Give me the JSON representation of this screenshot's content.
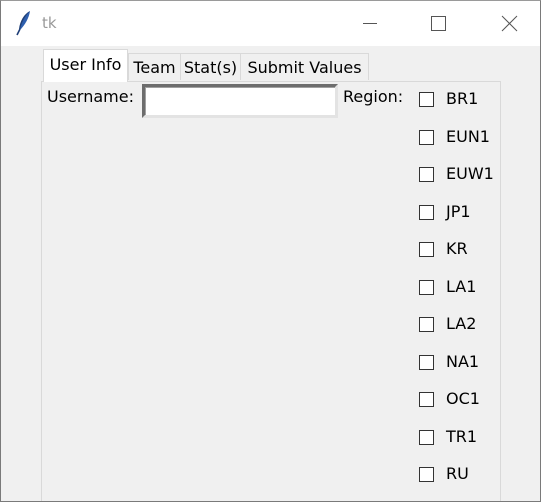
{
  "window": {
    "title": "tk",
    "icon": "feather-icon",
    "controls": [
      "minimize-icon",
      "maximize-icon",
      "close-icon"
    ]
  },
  "tabs": [
    {
      "label": "User Info",
      "selected": true
    },
    {
      "label": "Team",
      "selected": false
    },
    {
      "label": "Stat(s)",
      "selected": false
    },
    {
      "label": "Submit Values",
      "selected": false
    }
  ],
  "user_info": {
    "username_label": "Username:",
    "username_value": "",
    "region_label": "Region:",
    "regions": [
      {
        "label": "BR1",
        "checked": false
      },
      {
        "label": "EUN1",
        "checked": false
      },
      {
        "label": "EUW1",
        "checked": false
      },
      {
        "label": "JP1",
        "checked": false
      },
      {
        "label": "KR",
        "checked": false
      },
      {
        "label": "LA1",
        "checked": false
      },
      {
        "label": "LA2",
        "checked": false
      },
      {
        "label": "NA1",
        "checked": false
      },
      {
        "label": "OC1",
        "checked": false
      },
      {
        "label": "TR1",
        "checked": false
      },
      {
        "label": "RU",
        "checked": false
      }
    ]
  }
}
